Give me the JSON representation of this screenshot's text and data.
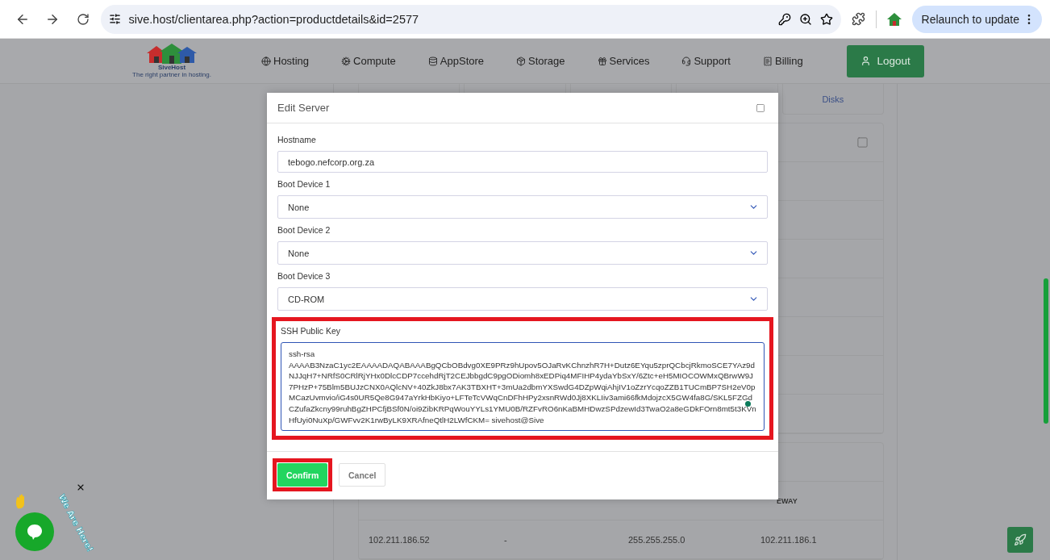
{
  "browser": {
    "url": "sive.host/clientarea.php?action=productdetails&id=2577",
    "relaunch_button": "Relaunch to update"
  },
  "site": {
    "logo_name": "SiveHost",
    "logo_tagline": "The right partner in hosting.",
    "nav": [
      {
        "label": "Hosting",
        "kind": "globe"
      },
      {
        "label": "Compute",
        "kind": "gear"
      },
      {
        "label": "AppStore",
        "kind": "database"
      },
      {
        "label": "Storage",
        "kind": "box"
      },
      {
        "label": "Services",
        "kind": "gift"
      },
      {
        "label": "Support",
        "kind": "headset"
      },
      {
        "label": "Billing",
        "kind": "receipt"
      }
    ],
    "logout": "Logout"
  },
  "background": {
    "tabs": [
      "Disks"
    ],
    "table": {
      "column_header": "EWAY",
      "row": [
        "102.211.186.52",
        "-",
        "255.255.255.0",
        "102.211.186.1"
      ]
    }
  },
  "modal": {
    "title": "Edit Server",
    "fields": [
      {
        "kind": "text",
        "label": "Hostname",
        "value": "tebogo.nefcorp.org.za"
      },
      {
        "kind": "select",
        "label": "Boot Device 1",
        "value": "None"
      },
      {
        "kind": "select",
        "label": "Boot Device 2",
        "value": "None"
      },
      {
        "kind": "select",
        "label": "Boot Device 3",
        "value": "CD-ROM"
      },
      {
        "kind": "textarea",
        "label": "SSH Public Key",
        "value": "ssh-rsa\nAAAAB3NzaC1yc2EAAAADAQABAAABgQCbOBdvg0XE9PRz9hUpov5OJaRvKChnzhR7H+Dutz6EYqu5zprQCbcjRkmoSCE7YAz9dNJJqH7+NRfS0CRlRjYHx0DlcCDP7ccehdRjT2CEJbbgdC9pgODiomh8xEDPiq4MFIHP4ydaYbSxY/6Ztc+eH5MIOCOWMxQBrwW9J7PHzP+75Blm5BUJzCNX0AQlcNV+40ZkJ8bx7AK3TBXHT+3mUa2dbmYXSwdG4DZpWqiAhjIV1oZzrYcqoZZB1TUCmBP7SH2eV0pMCazUvmvio/iG4s0UR5Qe8G947aYrkHbKiyo+LFTeTcVWqCnDFhHPy2xsnRWd0Jj8XKLIiv3ami66fkMdojzcX5GW4fa8G/SKL5FZGdCZufaZkcny99ruhBgZHPCfjBSf0N/oi9ZibKRPqWouYYLs1YMU0B/RZFvRO6nKaBMHDwzSPdzewId3TwaO2a8eGDkFOrn8mt5t3KVnHfUyi0NuXp/GWFvv2K1rwByLK9XRAfneQtlH2LWfCKM= sivehost@Sive",
        "highlighted": true
      }
    ],
    "buttons": [
      {
        "label": "Confirm",
        "kind": "primary",
        "highlighted": true
      },
      {
        "label": "Cancel",
        "kind": "secondary",
        "highlighted": false
      }
    ]
  },
  "chat": {
    "tagline": "We Are Here!"
  }
}
